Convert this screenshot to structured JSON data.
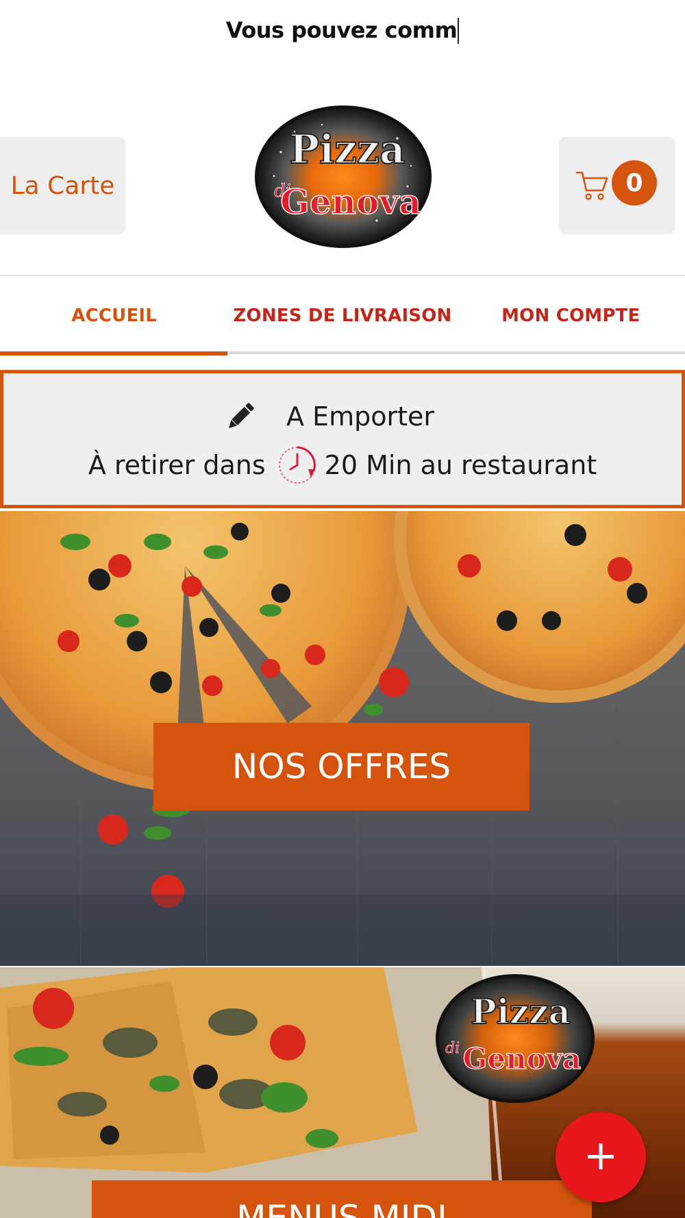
{
  "ticker": {
    "text": "Vous pouvez comm"
  },
  "header": {
    "menu_button_label": "La Carte",
    "logo": {
      "word1": "Pizza",
      "word2": "di",
      "word3": "Genova"
    },
    "cart": {
      "count": "0",
      "icon": "cart-icon"
    }
  },
  "tabs": [
    {
      "label": "ACCUEIL",
      "active": true
    },
    {
      "label": "ZONES DE LIVRAISON",
      "active": false
    },
    {
      "label": "MON COMPTE",
      "active": false
    }
  ],
  "order_mode": {
    "mode_label": "A Emporter",
    "pickup_prefix": "À retirer dans",
    "pickup_suffix": "20 Min au restaurant",
    "icons": [
      "pencil-icon",
      "clock-icon"
    ]
  },
  "banners": [
    {
      "label": "NOS OFFRES"
    },
    {
      "label": "MENUS MIDI"
    }
  ],
  "fab": {
    "label": "+"
  },
  "colors": {
    "accent": "#d4540e",
    "tab_text": "#c0261a",
    "fab": "#e8171c",
    "panel": "#efefef"
  }
}
